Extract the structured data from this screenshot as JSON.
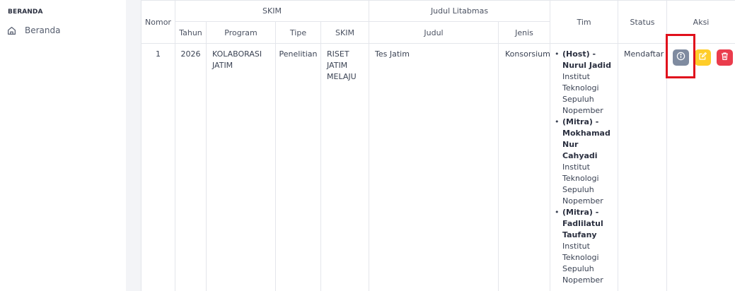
{
  "sidebar": {
    "heading": "BERANDA",
    "items": [
      {
        "label": "Beranda",
        "icon": "home-icon"
      }
    ]
  },
  "table": {
    "headers": {
      "nomor": "Nomor",
      "skim_group": "SKIM",
      "judul_group": "Judul Litabmas",
      "tim": "Tim",
      "status": "Status",
      "aksi": "Aksi",
      "tahun": "Tahun",
      "program": "Program",
      "tipe": "Tipe",
      "skim": "SKIM",
      "judul": "Judul",
      "jenis": "Jenis"
    },
    "rows": [
      {
        "nomor": "1",
        "tahun": "2026",
        "program": "KOLABORASI JATIM",
        "tipe": "Penelitian",
        "skim": "RISET JATIM MELAJU",
        "judul": "Tes Jatim",
        "jenis": "Konsorsium",
        "tim": [
          {
            "name": "(Host) - Nurul Jadid",
            "institution": "Institut Teknologi Sepuluh Nopember"
          },
          {
            "name": "(Mitra) - Mokhamad Nur Cahyadi",
            "institution": "Institut Teknologi Sepuluh Nopember"
          },
          {
            "name": "(Mitra) - Fadlilatul Taufany",
            "institution": "Institut Teknologi Sepuluh Nopember"
          }
        ],
        "status": "Mendaftar",
        "actions": [
          {
            "icon": "info-icon",
            "color": "#7f8ba0"
          },
          {
            "icon": "edit-icon",
            "color": "#ffcd29"
          },
          {
            "icon": "trash-icon",
            "color": "#ea3c4c"
          }
        ]
      }
    ]
  },
  "colors": {
    "highlight": "#e0101c",
    "gutter": "#f3f4f7",
    "border": "#e4e6eb"
  }
}
